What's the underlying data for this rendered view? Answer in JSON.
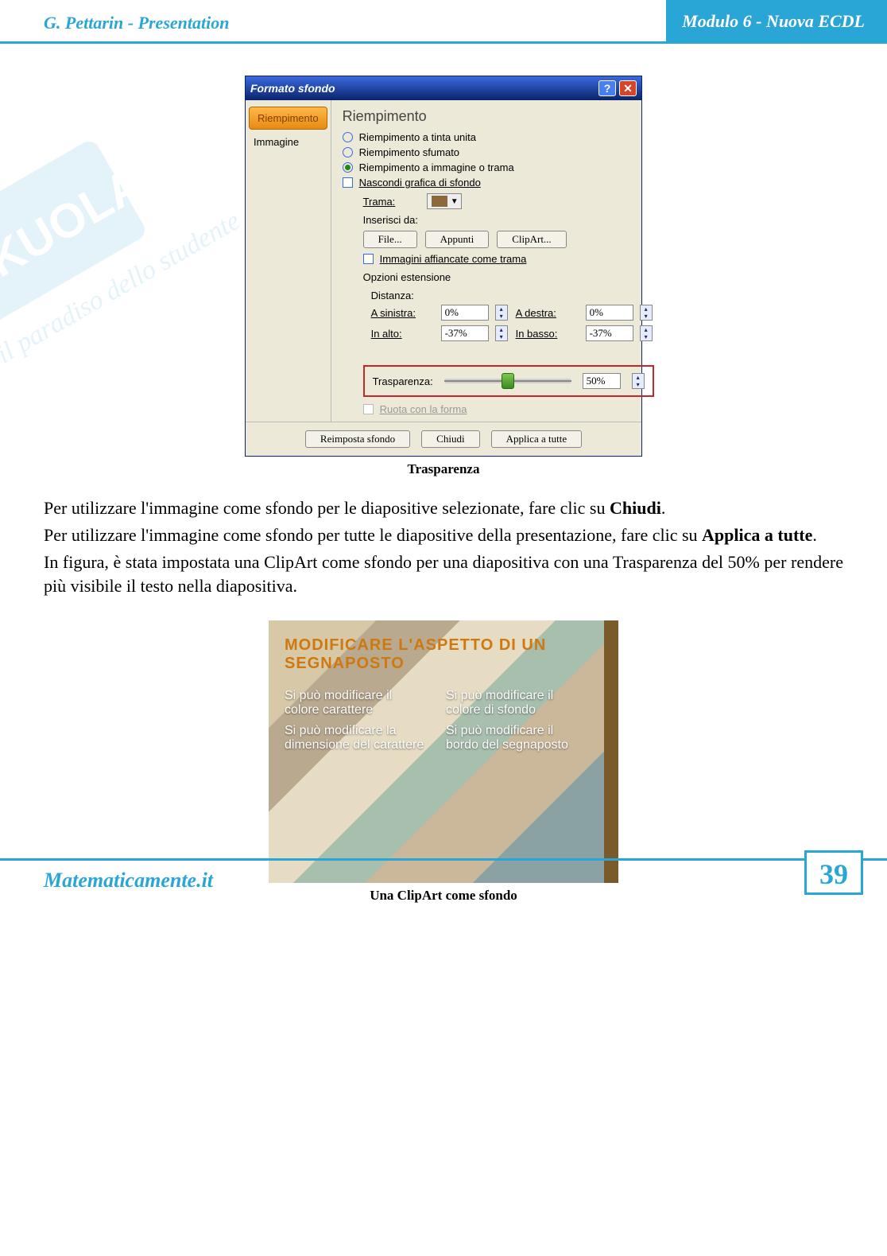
{
  "header": {
    "left": "G. Pettarin - Presentation",
    "right": "Modulo 6 - Nuova ECDL"
  },
  "watermark": {
    "brand": "SKUOLA",
    "tag": "il paradiso dello studente"
  },
  "dialog": {
    "title": "Formato sfondo",
    "tabs": {
      "riempimento": "Riempimento",
      "immagine": "Immagine"
    },
    "panel_title": "Riempimento",
    "options": {
      "solid": "Riempimento a tinta unita",
      "gradient": "Riempimento sfumato",
      "picture": "Riempimento a immagine o trama",
      "hide_bg": "Nascondi grafica di sfondo"
    },
    "labels": {
      "trama": "Trama:",
      "inserisci_da": "Inserisci da:",
      "file": "File...",
      "appunti": "Appunti",
      "clipart": "ClipArt...",
      "tile": "Immagini affiancate come trama",
      "opzioni": "Opzioni estensione",
      "distanza": "Distanza:",
      "sinistra": "A sinistra:",
      "destra": "A destra:",
      "alto": "In alto:",
      "basso": "In basso:",
      "trasparenza": "Trasparenza:",
      "ruota": "Ruota con la forma",
      "reimposta": "Reimposta sfondo",
      "chiudi": "Chiudi",
      "applica": "Applica a tutte"
    },
    "values": {
      "sinistra": "0%",
      "destra": "0%",
      "alto": "-37%",
      "basso": "-37%",
      "trasparenza": "50%"
    }
  },
  "captions": {
    "fig1": "Trasparenza",
    "fig2": "Una ClipArt come sfondo"
  },
  "paragraphs": {
    "p1a": "Per utilizzare l'immagine come sfondo per le diapositive selezionate, fare clic su ",
    "p1b": "Chiudi",
    "p1c": ".",
    "p2a": "Per utilizzare l'immagine come sfondo per tutte le diapositive della presentazione, fare clic su ",
    "p2b": "Applica a tutte",
    "p2c": ".",
    "p3": "In figura, è stata impostata una ClipArt come sfondo per una diapositiva con una Trasparenza del 50% per rendere più visibile il testo nella diapositiva."
  },
  "slide": {
    "title": "MODIFICARE L'ASPETTO DI UN SEGNAPOSTO",
    "col1": {
      "a": "Si può modificare il colore carattere",
      "b": "Si può modificare la dimensione del carattere"
    },
    "col2": {
      "a": "Si può modificare il colore di sfondo",
      "b": "Si può modificare il bordo del segnaposto"
    }
  },
  "footer": {
    "site": "Matematicamente.it",
    "page": "39"
  }
}
